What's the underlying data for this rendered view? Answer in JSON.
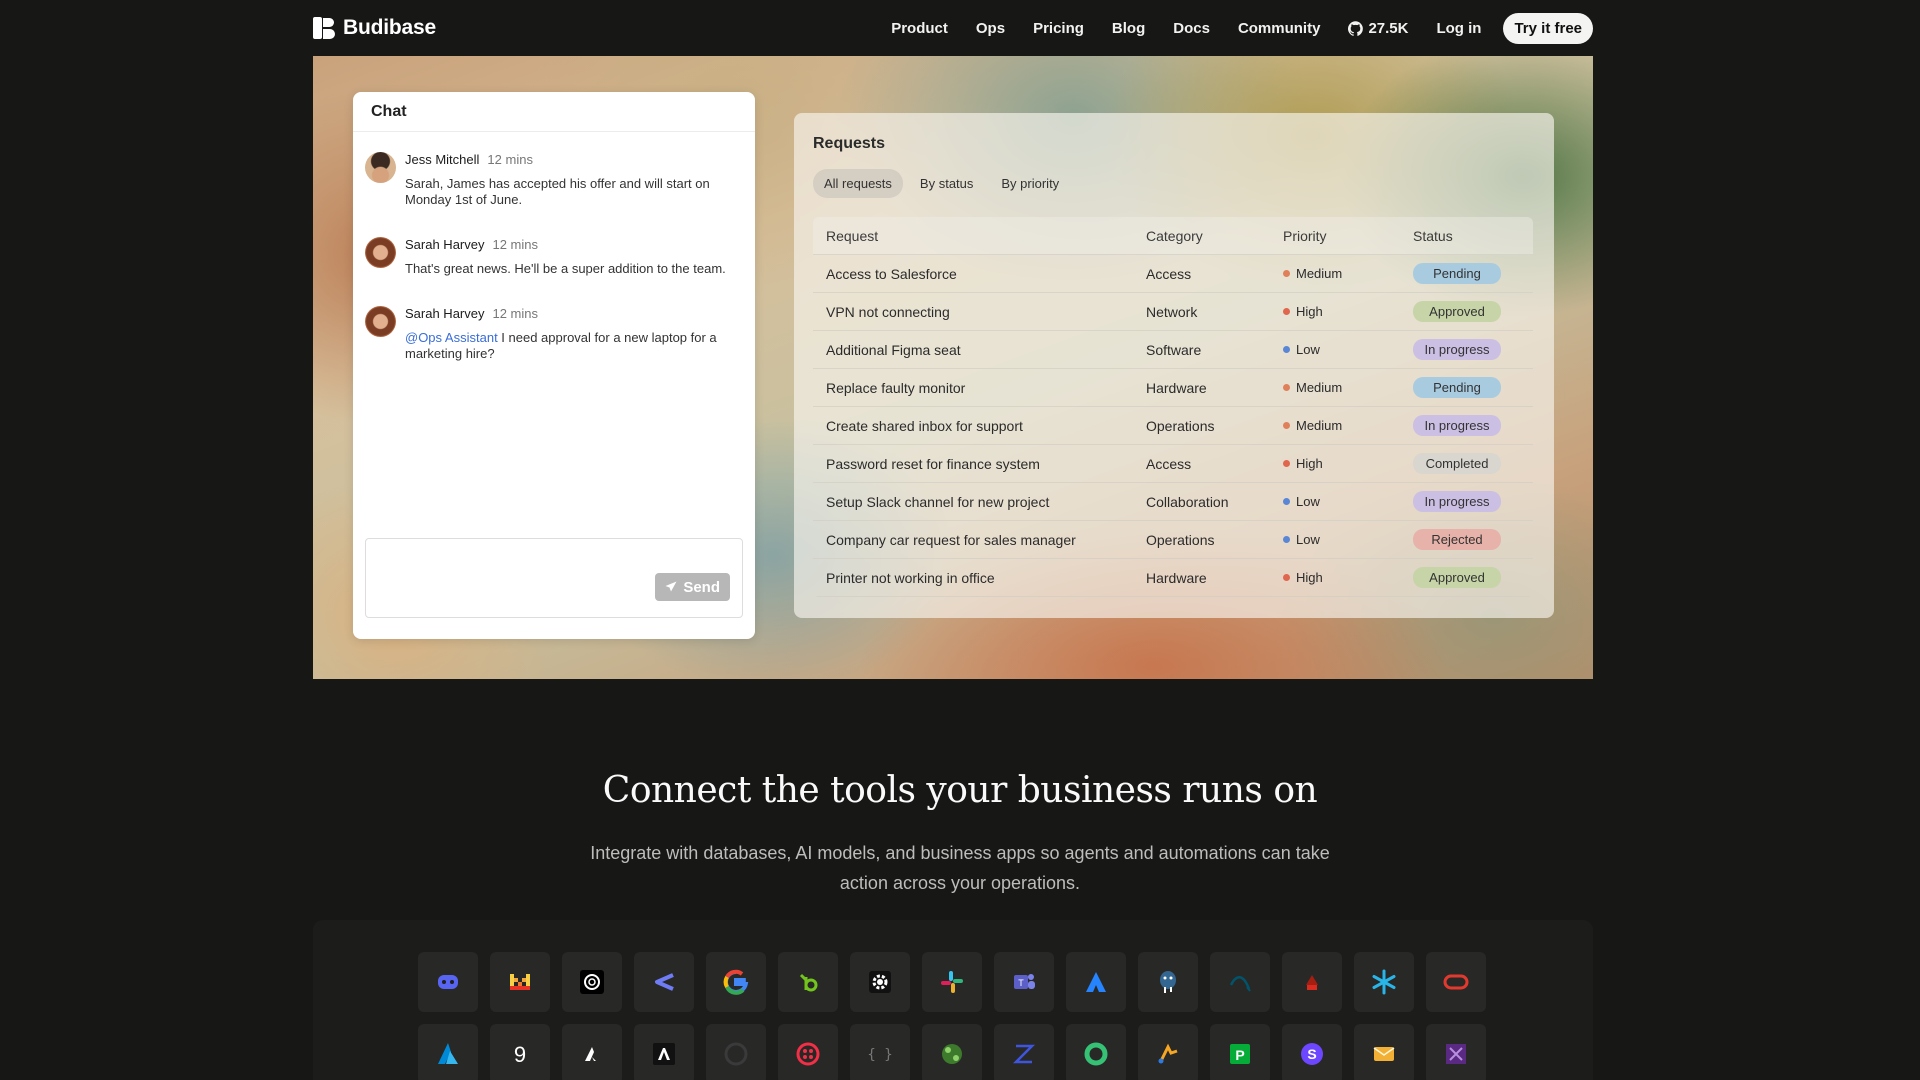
{
  "nav": {
    "brand": "Budibase",
    "links": [
      "Product",
      "Ops",
      "Pricing",
      "Blog",
      "Docs",
      "Community"
    ],
    "github_stars": "27.5K",
    "login": "Log in",
    "cta": "Try it free"
  },
  "chat": {
    "title": "Chat",
    "messages": [
      {
        "name": "Jess Mitchell",
        "time": "12 mins",
        "text": "Sarah, James has accepted his offer and will start on Monday 1st of June."
      },
      {
        "name": "Sarah Harvey",
        "time": "12 mins",
        "text": "That's great news. He'll be a super addition to the team."
      },
      {
        "name": "Sarah Harvey",
        "time": "12 mins",
        "mention": "@Ops Assistant",
        "text": " I need approval for a new laptop for a marketing hire?"
      }
    ],
    "send_label": "Send"
  },
  "requests": {
    "title": "Requests",
    "tabs": [
      "All requests",
      "By status",
      "By priority"
    ],
    "columns": [
      "Request",
      "Category",
      "Priority",
      "Status"
    ],
    "rows": [
      {
        "request": "Access to Salesforce",
        "category": "Access",
        "priority": "Medium",
        "status": "Pending"
      },
      {
        "request": "VPN not connecting",
        "category": "Network",
        "priority": "High",
        "status": "Approved"
      },
      {
        "request": "Additional Figma seat",
        "category": "Software",
        "priority": "Low",
        "status": "In progress"
      },
      {
        "request": "Replace faulty monitor",
        "category": "Hardware",
        "priority": "Medium",
        "status": "Pending"
      },
      {
        "request": "Create shared inbox for support",
        "category": "Operations",
        "priority": "Medium",
        "status": "In progress"
      },
      {
        "request": "Password reset for finance system",
        "category": "Access",
        "priority": "High",
        "status": "Completed"
      },
      {
        "request": "Setup Slack channel for new project",
        "category": "Collaboration",
        "priority": "Low",
        "status": "In progress"
      },
      {
        "request": "Company car request for sales manager",
        "category": "Operations",
        "priority": "Low",
        "status": "Rejected"
      },
      {
        "request": "Printer not working in office",
        "category": "Hardware",
        "priority": "High",
        "status": "Approved"
      }
    ],
    "priority_colors": {
      "High": "#e0664e",
      "Medium": "#e0805a",
      "Low": "#5a86d6"
    },
    "status_colors": {
      "Pending": "#a9cbe0",
      "Approved": "#c6d4a8",
      "In progress": "#cbbfe3",
      "Completed": "#d8d6cf",
      "Rejected": "#e6b2a9"
    }
  },
  "integrations": {
    "heading": "Connect the tools your business runs on",
    "subtext": "Integrate with databases, AI models, and business apps so agents and automations can take action across your operations.",
    "icons": [
      "discord-icon",
      "mistral-icon",
      "openai-icon",
      "arrows-icon",
      "google-icon",
      "bamboohr-icon",
      "gear-icon",
      "slack-icon",
      "teams-icon",
      "atlassian-icon",
      "postgres-icon",
      "mysql-icon",
      "redis-icon",
      "snowflake-icon",
      "oracle-icon",
      "azure-icon",
      "nine-icon",
      "affinity-icon",
      "anthropic-icon",
      "github-icon",
      "twilio-icon",
      "rest-icon",
      "couchdb-icon",
      "zendesk-icon",
      "circle-icon",
      "arcgis-icon",
      "pagerduty-icon",
      "s-icon",
      "email-icon",
      "purple-icon"
    ]
  }
}
